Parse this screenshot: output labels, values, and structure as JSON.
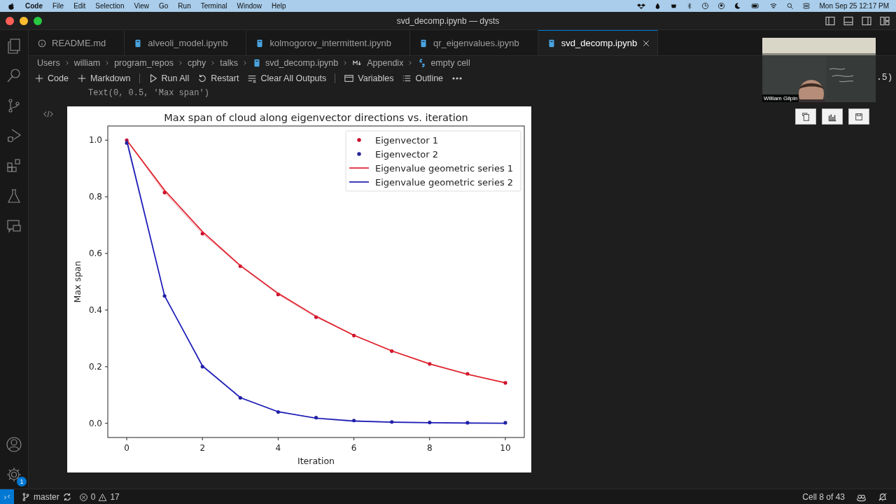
{
  "menu_bar": {
    "app": "Code",
    "items": [
      "File",
      "Edit",
      "Selection",
      "View",
      "Go",
      "Run",
      "Terminal",
      "Window",
      "Help"
    ],
    "clock": "Mon Sep 25  12:17 PM"
  },
  "window": {
    "title": "svd_decomp.ipynb — dysts"
  },
  "activity_bar": {
    "settings_badge": "1"
  },
  "tabs": [
    {
      "label": "README.md",
      "kind": "info",
      "selected": false
    },
    {
      "label": "alveoli_model.ipynb",
      "kind": "notebook",
      "selected": false
    },
    {
      "label": "kolmogorov_intermittent.ipynb",
      "kind": "notebook",
      "selected": false
    },
    {
      "label": "qr_eigenvalues.ipynb",
      "kind": "notebook",
      "selected": false
    },
    {
      "label": "svd_decomp.ipynb",
      "kind": "notebook",
      "selected": true
    }
  ],
  "breadcrumbs": [
    {
      "label": "Users",
      "kind": "folder"
    },
    {
      "label": "william",
      "kind": "folder"
    },
    {
      "label": "program_repos",
      "kind": "folder"
    },
    {
      "label": "cphy",
      "kind": "folder"
    },
    {
      "label": "talks",
      "kind": "folder"
    },
    {
      "label": "svd_decomp.ipynb",
      "kind": "notebook"
    },
    {
      "label": "Appendix",
      "kind": "markdown"
    },
    {
      "label": "empty cell",
      "kind": "python"
    }
  ],
  "toolbar": [
    {
      "label": "Code",
      "kind": "add"
    },
    {
      "label": "Markdown",
      "kind": "add"
    },
    {
      "label": "Run All",
      "kind": "run"
    },
    {
      "label": "Restart",
      "kind": "restart"
    },
    {
      "label": "Clear All Outputs",
      "kind": "clear"
    },
    {
      "label": "Variables",
      "kind": "variables"
    },
    {
      "label": "Outline",
      "kind": "outline"
    }
  ],
  "cell": {
    "code_line": "Text(0, 0.5, 'Max span')",
    "side_text": ".5)",
    "markers_only": [
      true,
      true,
      false,
      false
    ],
    "chart_data": {
      "type": "line",
      "title": "Max span of cloud along eigenvector directions vs. iteration",
      "xlabel": "Iteration",
      "ylabel": "Max span",
      "x": [
        0,
        1,
        2,
        3,
        4,
        5,
        6,
        7,
        8,
        9,
        10
      ],
      "legend": "upper right",
      "xlim": [
        -0.5,
        10.5
      ],
      "ylim": [
        -0.05,
        1.05
      ],
      "xticks": [
        0,
        2,
        4,
        6,
        8,
        10
      ],
      "yticks": [
        {
          "value": 0,
          "label": "0.0"
        },
        {
          "value": 0.2,
          "label": "0.2"
        },
        {
          "value": 0.4,
          "label": "0.4"
        },
        {
          "value": 0.6,
          "label": "0.6"
        },
        {
          "value": 0.8,
          "label": "0.8"
        },
        {
          "value": 1,
          "label": "1.0"
        }
      ],
      "series": [
        {
          "name": "Eigenvector 1",
          "color": "#c8102e",
          "values": [
            1.0,
            0.815,
            0.67,
            0.555,
            0.455,
            0.375,
            0.31,
            0.255,
            0.21,
            0.175,
            0.143
          ]
        },
        {
          "name": "Eigenvector 2",
          "color": "#26269a",
          "values": [
            0.99,
            0.45,
            0.2,
            0.09,
            0.04,
            0.02,
            0.01,
            0.005,
            0.003,
            0.002,
            0.002
          ]
        },
        {
          "name": "Eigenvalue geometric series 1",
          "color": "#e0202a",
          "values": [
            1.0,
            0.823,
            0.677,
            0.557,
            0.459,
            0.378,
            0.311,
            0.256,
            0.21,
            0.173,
            0.143
          ]
        },
        {
          "name": "Eigenvalue geometric series 2",
          "color": "#1c1cb8",
          "values": [
            1.0,
            0.45,
            0.203,
            0.091,
            0.041,
            0.018,
            0.008,
            0.004,
            0.002,
            0.001,
            0.0
          ]
        }
      ]
    }
  },
  "video_call": {
    "name": "William Gilpin"
  },
  "status_bar": {
    "branch": "master",
    "errors": "0",
    "warnings": "17",
    "cell_position": "Cell 8 of 43"
  }
}
